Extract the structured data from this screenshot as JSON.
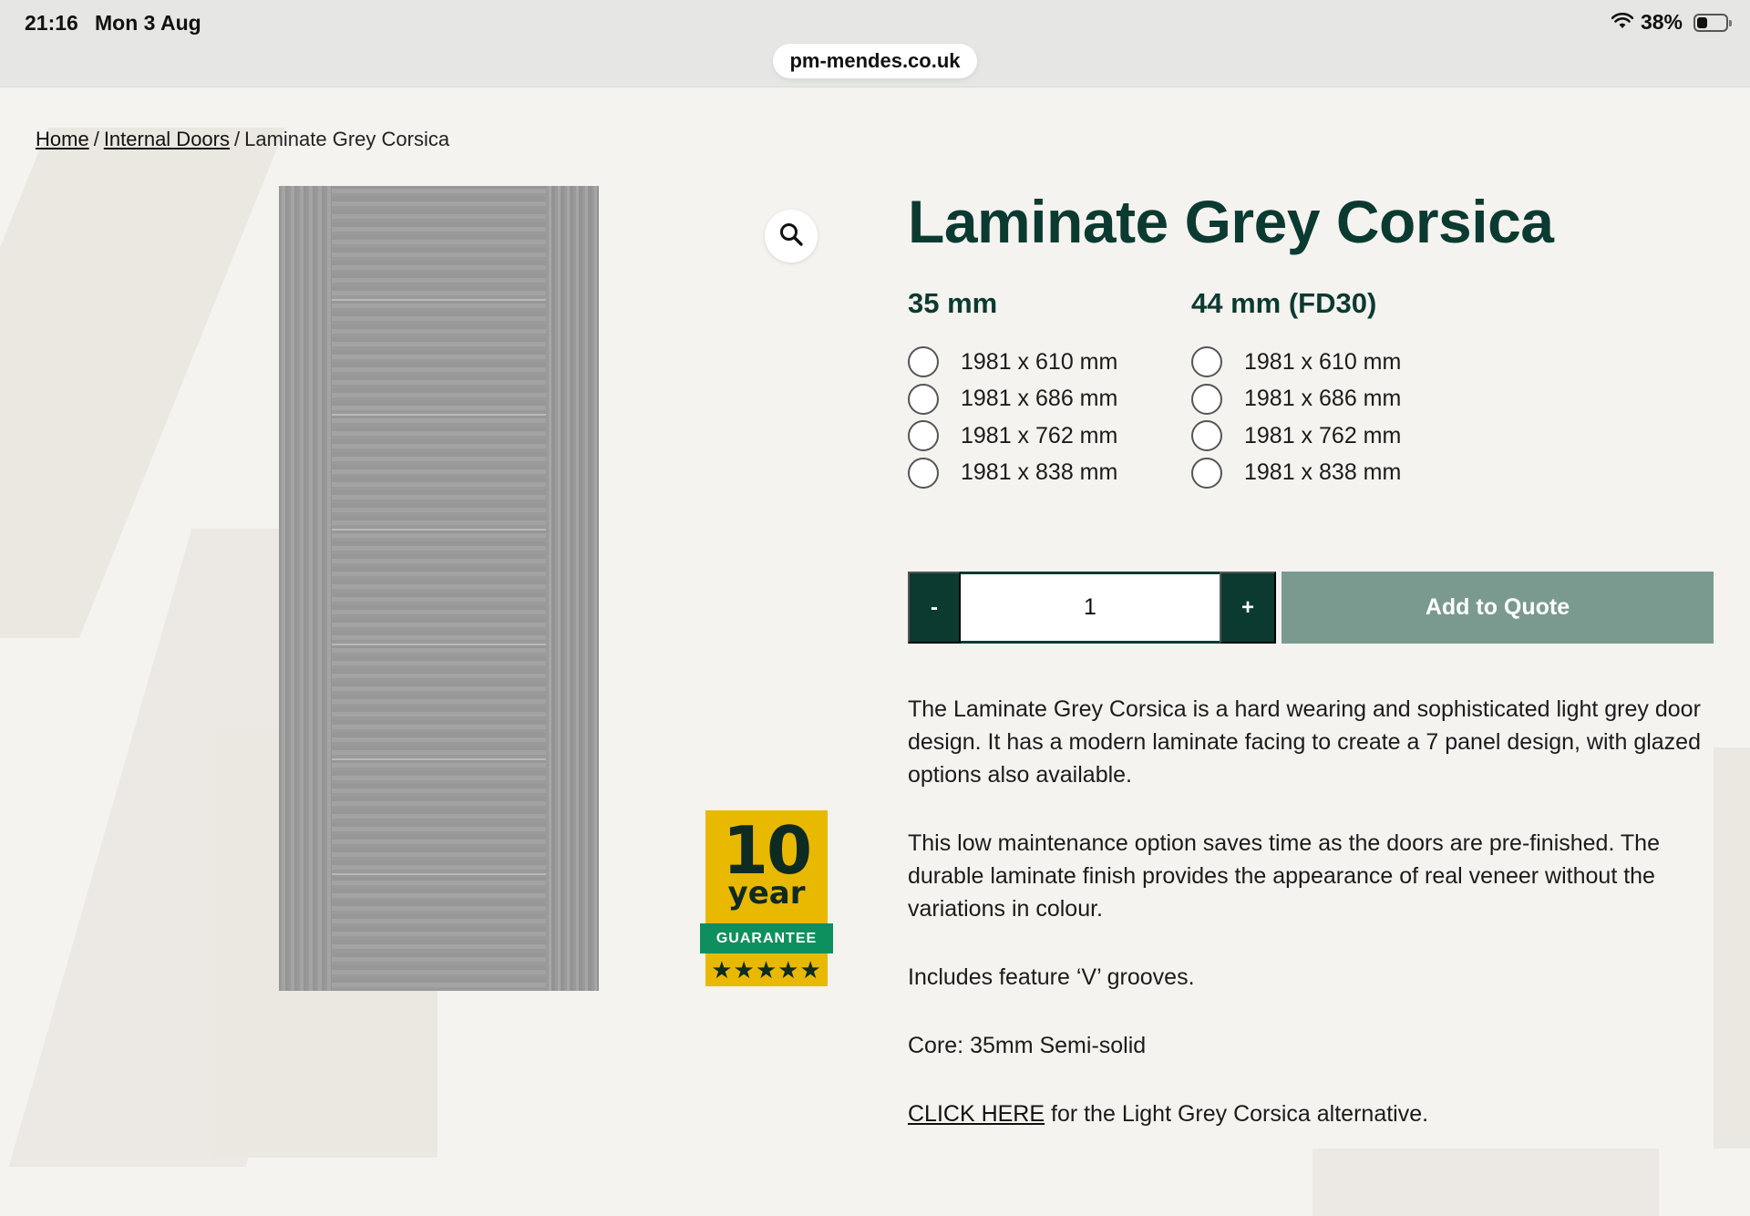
{
  "status_bar": {
    "time": "21:16",
    "date": "Mon 3 Aug",
    "battery": "38%"
  },
  "browser": {
    "url": "pm-mendes.co.uk"
  },
  "breadcrumb": {
    "home": "Home",
    "category": "Internal Doors",
    "current": "Laminate Grey Corsica",
    "separator": "/"
  },
  "badge": {
    "number": "10",
    "unit": "year",
    "strip": "GUARANTEE",
    "stars": "★★★★★"
  },
  "product": {
    "title": "Laminate Grey Corsica",
    "size_groups": [
      {
        "heading": "35 mm",
        "options": [
          "1981 x 610 mm",
          "1981 x 686 mm",
          "1981 x 762 mm",
          "1981 x 838 mm"
        ]
      },
      {
        "heading": "44 mm (FD30)",
        "options": [
          "1981 x 610 mm",
          "1981 x 686 mm",
          "1981 x 762 mm",
          "1981 x 838 mm"
        ]
      }
    ],
    "quantity": "1",
    "minus_label": "-",
    "plus_label": "+",
    "add_label": "Add to Quote",
    "description": [
      "The Laminate Grey Corsica is a hard wearing and sophisticated light grey door design. It has a modern laminate facing to create a 7 panel design, with glazed options also available.",
      "This low maintenance option saves time as the doors are pre-finished. The durable laminate finish provides the appearance of real veneer without the variations in colour.",
      "Includes feature ‘V’ grooves.",
      "Core: 35mm Semi-solid"
    ],
    "link_text": "CLICK HERE",
    "link_suffix": " for the Light Grey Corsica alternative."
  },
  "colors": {
    "brand_green": "#0b3a31",
    "add_button": "#7a9a90",
    "badge_yellow": "#e9b800",
    "badge_green": "#0e8f5e"
  }
}
